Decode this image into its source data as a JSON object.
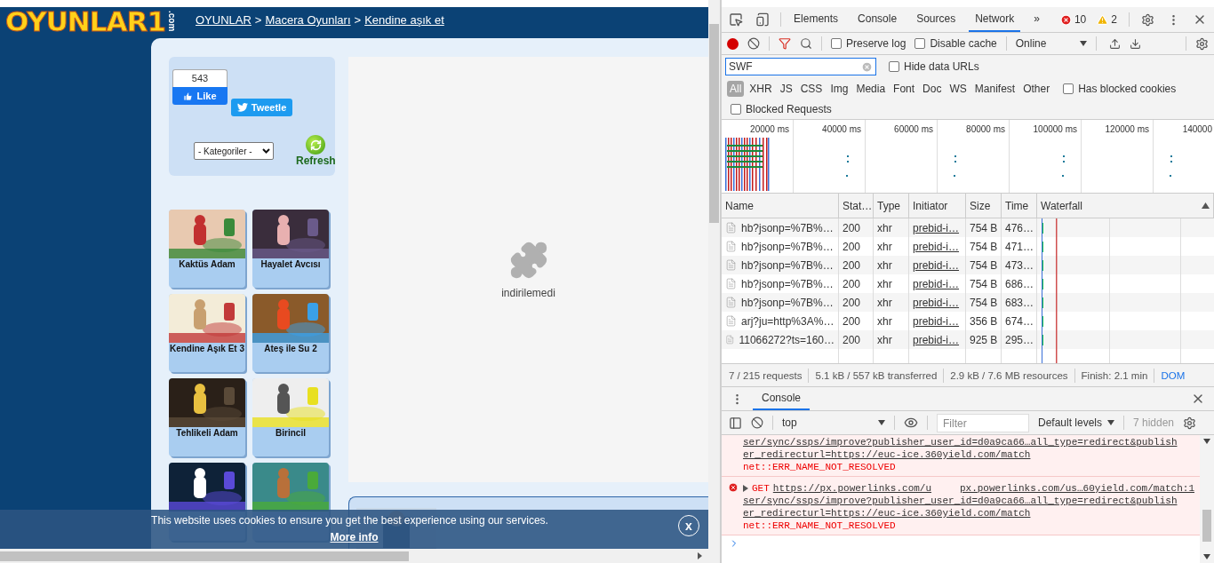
{
  "page": {
    "logo": {
      "text": "OYUNLAR1",
      "suffix": ".com"
    },
    "breadcrumb": {
      "separator": ">",
      "links": [
        "OYUNLAR",
        "Macera Oyunları",
        "Kendine aşık et"
      ]
    },
    "share": {
      "like_count": "543",
      "like_label": "Like",
      "tweet_label": "Tweetle"
    },
    "category_select": "- Kategoriler -",
    "refresh_label": "Refresh",
    "games": [
      {
        "kind": "titled",
        "title": "Kaktüs Adam"
      },
      {
        "kind": "titled",
        "title": "Hayalet Avcısı"
      },
      {
        "kind": "titled",
        "title": "Kendine Aşık Et 3"
      },
      {
        "kind": "titled",
        "title": "Ateş ile Su 2"
      },
      {
        "kind": "titled",
        "title": "Tehlikeli Adam"
      },
      {
        "kind": "titled",
        "title": "Birincil"
      },
      {
        "kind": "covered"
      },
      {
        "kind": "covered"
      }
    ],
    "player": {
      "message": "indirilemedi"
    },
    "cookie_banner": {
      "text": "This website uses cookies to ensure you get the best experience using our services.",
      "link": "More info",
      "close": "x"
    }
  },
  "devtools": {
    "tabs": [
      {
        "label": "Elements",
        "selected": false
      },
      {
        "label": "Console",
        "selected": false
      },
      {
        "label": "Sources",
        "selected": false
      },
      {
        "label": "Network",
        "selected": true
      }
    ],
    "more_tabs": "»",
    "error_count": "10",
    "warning_count": "2",
    "toolbar": {
      "recording": true,
      "preserve_log": {
        "label": "Preserve log",
        "checked": false
      },
      "disable_cache": {
        "label": "Disable cache",
        "checked": false
      },
      "throttling": "Online"
    },
    "filter": {
      "value": "SWF",
      "hide_data_urls": {
        "label": "Hide data URLs",
        "checked": false
      }
    },
    "type_filters": [
      {
        "label": "All",
        "selected": true
      },
      {
        "label": "XHR",
        "selected": false
      },
      {
        "label": "JS",
        "selected": false
      },
      {
        "label": "CSS",
        "selected": false
      },
      {
        "label": "Img",
        "selected": false
      },
      {
        "label": "Media",
        "selected": false
      },
      {
        "label": "Font",
        "selected": false
      },
      {
        "label": "Doc",
        "selected": false
      },
      {
        "label": "WS",
        "selected": false
      },
      {
        "label": "Manifest",
        "selected": false
      },
      {
        "label": "Other",
        "selected": false
      }
    ],
    "has_blocked_cookies": {
      "label": "Has blocked cookies",
      "checked": false
    },
    "blocked_requests": {
      "label": "Blocked Requests",
      "checked": false
    },
    "overview_ticks": [
      "20000 ms",
      "40000 ms",
      "60000 ms",
      "80000 ms",
      "100000 ms",
      "120000 ms",
      "140000"
    ],
    "table": {
      "columns": [
        "Name",
        "Stat…",
        "Type",
        "Initiator",
        "Size",
        "Time",
        "Waterfall"
      ],
      "rows": [
        {
          "name": "hb?jsonp=%7B%…",
          "status": "200",
          "type": "xhr",
          "initiator": "prebid-i…",
          "size": "754 B",
          "time": "476…"
        },
        {
          "name": "hb?jsonp=%7B%…",
          "status": "200",
          "type": "xhr",
          "initiator": "prebid-i…",
          "size": "754 B",
          "time": "471…"
        },
        {
          "name": "hb?jsonp=%7B%…",
          "status": "200",
          "type": "xhr",
          "initiator": "prebid-i…",
          "size": "754 B",
          "time": "473…"
        },
        {
          "name": "hb?jsonp=%7B%…",
          "status": "200",
          "type": "xhr",
          "initiator": "prebid-i…",
          "size": "754 B",
          "time": "686…"
        },
        {
          "name": "hb?jsonp=%7B%…",
          "status": "200",
          "type": "xhr",
          "initiator": "prebid-i…",
          "size": "754 B",
          "time": "683…"
        },
        {
          "name": "arj?ju=http%3A%…",
          "status": "200",
          "type": "xhr",
          "initiator": "prebid-i…",
          "size": "356 B",
          "time": "674…"
        },
        {
          "name": "11066272?ts=160…",
          "status": "200",
          "type": "xhr",
          "initiator": "prebid-i…",
          "size": "925 B",
          "time": "295…"
        }
      ]
    },
    "summary": [
      "7 / 215 requests",
      "5.1 kB / 557 kB transferred",
      "2.9 kB / 7.6 MB resources",
      "Finish: 2.1 min"
    ],
    "summary_link": "DOM",
    "console": {
      "tab": "Console",
      "context": "top",
      "filter_placeholder": "Filter",
      "levels": "Default levels",
      "hidden": "7 hidden",
      "messages": [
        {
          "kind": "continuation",
          "lines": [
            "ser/sync/ssps/improve?publisher_user_id=d0a9ca66…all_type=redirect&publish",
            "er_redirecturl=https://euc-ice.360yield.com/match"
          ],
          "error": "net::ERR_NAME_NOT_RESOLVED"
        },
        {
          "kind": "request",
          "method": "GET",
          "url": "https://px.powerlinks.com/u",
          "source": "px.powerlinks.com/us…60yield.com/match:1",
          "lines": [
            "ser/sync/ssps/improve?publisher_user_id=d0a9ca66…all_type=redirect&publish",
            "er_redirecturl=https://euc-ice.360yield.com/match"
          ],
          "error": "net::ERR_NAME_NOT_RESOLVED"
        }
      ]
    }
  }
}
